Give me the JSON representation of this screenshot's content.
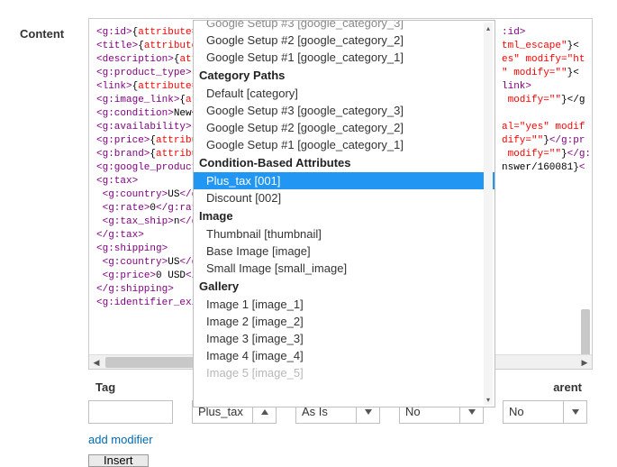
{
  "label": "Content",
  "code_lines": [
    {
      "segments": [
        {
          "t": "tag",
          "v": "<g:id>"
        },
        {
          "t": "txt",
          "v": "{"
        },
        {
          "t": "attr",
          "v": "attribute=\"ba"
        }
      ],
      "right": [
        {
          "t": "tag",
          "v": ":id>"
        }
      ]
    },
    {
      "segments": [
        {
          "t": "tag",
          "v": "<title>"
        },
        {
          "t": "txt",
          "v": "{"
        },
        {
          "t": "attr",
          "v": "attribute=\"p"
        }
      ],
      "right": [
        {
          "t": "attr",
          "v": "tml_escape\""
        },
        {
          "t": "txt",
          "v": "}<"
        }
      ]
    },
    {
      "segments": [
        {
          "t": "tag",
          "v": "<description>"
        },
        {
          "t": "txt",
          "v": "{"
        },
        {
          "t": "attr",
          "v": "attrib"
        }
      ],
      "right": [
        {
          "t": "attr",
          "v": "es\" modify=\"ht"
        }
      ]
    },
    {
      "segments": [
        {
          "t": "tag",
          "v": "<g:product_type>"
        },
        {
          "t": "txt",
          "v": "{"
        },
        {
          "t": "attr",
          "v": "att"
        }
      ],
      "right": [
        {
          "t": "attr",
          "v": "\" modify=\"\""
        },
        {
          "t": "txt",
          "v": "}<"
        }
      ]
    },
    {
      "segments": [
        {
          "t": "tag",
          "v": "<link>"
        },
        {
          "t": "txt",
          "v": "{"
        },
        {
          "t": "attr",
          "v": "attribute=\"ur"
        }
      ],
      "right": [
        {
          "t": "tag",
          "v": "link>"
        }
      ]
    },
    {
      "segments": [
        {
          "t": "tag",
          "v": "<g:image_link>"
        },
        {
          "t": "txt",
          "v": "{"
        },
        {
          "t": "attr",
          "v": "attri"
        }
      ],
      "right": [
        {
          "t": "attr",
          "v": " modify=\"\""
        },
        {
          "t": "txt",
          "v": "}</g"
        }
      ]
    },
    {
      "segments": [
        {
          "t": "tag",
          "v": "<g:condition>"
        },
        {
          "t": "txt",
          "v": "New"
        },
        {
          "t": "tag",
          "v": "</g:"
        }
      ],
      "right": []
    },
    {
      "segments": [
        {
          "t": "tag",
          "v": "<g:availability>"
        },
        {
          "t": "txt",
          "v": "{"
        },
        {
          "t": "attr",
          "v": "att"
        }
      ],
      "right": [
        {
          "t": "attr",
          "v": "al=\"yes\" modif"
        }
      ]
    },
    {
      "segments": [
        {
          "t": "tag",
          "v": "<g:price>"
        },
        {
          "t": "txt",
          "v": "{"
        },
        {
          "t": "attr",
          "v": "attribute="
        }
      ],
      "right": [
        {
          "t": "attr",
          "v": "dify=\"\""
        },
        {
          "t": "txt",
          "v": "}"
        },
        {
          "t": "tag",
          "v": "</g:pr"
        }
      ]
    },
    {
      "segments": [
        {
          "t": "tag",
          "v": "<g:brand>"
        },
        {
          "t": "txt",
          "v": "{"
        },
        {
          "t": "attr",
          "v": "attribute="
        }
      ],
      "right": [
        {
          "t": "attr",
          "v": " modify=\"\""
        },
        {
          "t": "txt",
          "v": "}"
        },
        {
          "t": "tag",
          "v": "</g:"
        }
      ]
    },
    {
      "segments": [
        {
          "t": "tag",
          "v": "<g:google_product_ca"
        }
      ],
      "right": [
        {
          "t": "txt",
          "v": "nswer/160081}"
        },
        {
          "t": "tag",
          "v": "<"
        }
      ]
    },
    {
      "segments": [
        {
          "t": "tag",
          "v": "<g:tax>"
        }
      ],
      "right": []
    },
    {
      "segments": [
        {
          "t": "txt",
          "v": " "
        },
        {
          "t": "tag",
          "v": "<g:country>"
        },
        {
          "t": "txt",
          "v": "US"
        },
        {
          "t": "tag",
          "v": "</g:c"
        }
      ],
      "right": []
    },
    {
      "segments": [
        {
          "t": "txt",
          "v": " "
        },
        {
          "t": "tag",
          "v": "<g:rate>"
        },
        {
          "t": "txt",
          "v": "0"
        },
        {
          "t": "tag",
          "v": "</g:rate>"
        }
      ],
      "right": []
    },
    {
      "segments": [
        {
          "t": "txt",
          "v": " "
        },
        {
          "t": "tag",
          "v": "<g:tax_ship>"
        },
        {
          "t": "txt",
          "v": "n"
        },
        {
          "t": "tag",
          "v": "</g:ta"
        }
      ],
      "right": []
    },
    {
      "segments": [
        {
          "t": "tag",
          "v": "</g:tax>"
        }
      ],
      "right": []
    },
    {
      "segments": [
        {
          "t": "tag",
          "v": "<g:shipping>"
        }
      ],
      "right": []
    },
    {
      "segments": [
        {
          "t": "txt",
          "v": " "
        },
        {
          "t": "tag",
          "v": "<g:country>"
        },
        {
          "t": "txt",
          "v": "US"
        },
        {
          "t": "tag",
          "v": "</g:co"
        }
      ],
      "right": []
    },
    {
      "segments": [
        {
          "t": "txt",
          "v": " "
        },
        {
          "t": "tag",
          "v": "<g:price>"
        },
        {
          "t": "txt",
          "v": "0 USD"
        },
        {
          "t": "tag",
          "v": "</g:p"
        }
      ],
      "right": []
    },
    {
      "segments": [
        {
          "t": "tag",
          "v": "</g:shipping>"
        }
      ],
      "right": []
    },
    {
      "segments": [
        {
          "t": "tag",
          "v": "<g:identifier_exists"
        }
      ],
      "right": []
    }
  ],
  "dropdown": {
    "groups": [
      {
        "header": null,
        "items": [
          {
            "label": "Google Setup #3 [google_category_3]",
            "partial": true
          },
          {
            "label": "Google Setup #2 [google_category_2]"
          },
          {
            "label": "Google Setup #1 [google_category_1]"
          }
        ]
      },
      {
        "header": "Category Paths",
        "items": [
          {
            "label": "Default [category]"
          },
          {
            "label": "Google Setup #3 [google_category_3]"
          },
          {
            "label": "Google Setup #2 [google_category_2]"
          },
          {
            "label": "Google Setup #1 [google_category_1]"
          }
        ]
      },
      {
        "header": "Condition-Based Attributes",
        "items": [
          {
            "label": "Plus_tax [001]",
            "selected": true
          },
          {
            "label": "Discount [002]"
          }
        ]
      },
      {
        "header": "Image",
        "items": [
          {
            "label": "Thumbnail [thumbnail]"
          },
          {
            "label": "Base Image [image]"
          },
          {
            "label": "Small Image [small_image]"
          }
        ]
      },
      {
        "header": "Gallery",
        "items": [
          {
            "label": "Image 1 [image_1]"
          },
          {
            "label": "Image 2 [image_2]"
          },
          {
            "label": "Image 3 [image_3]"
          },
          {
            "label": "Image 4 [image_4]"
          },
          {
            "label": "Image 5 [image_5]",
            "partial": true
          }
        ]
      }
    ]
  },
  "toolbar": {
    "tag_label": "Tag",
    "parent_label": "arent",
    "attribute_value": "Plus_tax",
    "modifier_value": "As Is",
    "no1": "No",
    "no2": "No",
    "add_modifier": "add modifier",
    "insert": "Insert",
    "tag_value": ""
  }
}
